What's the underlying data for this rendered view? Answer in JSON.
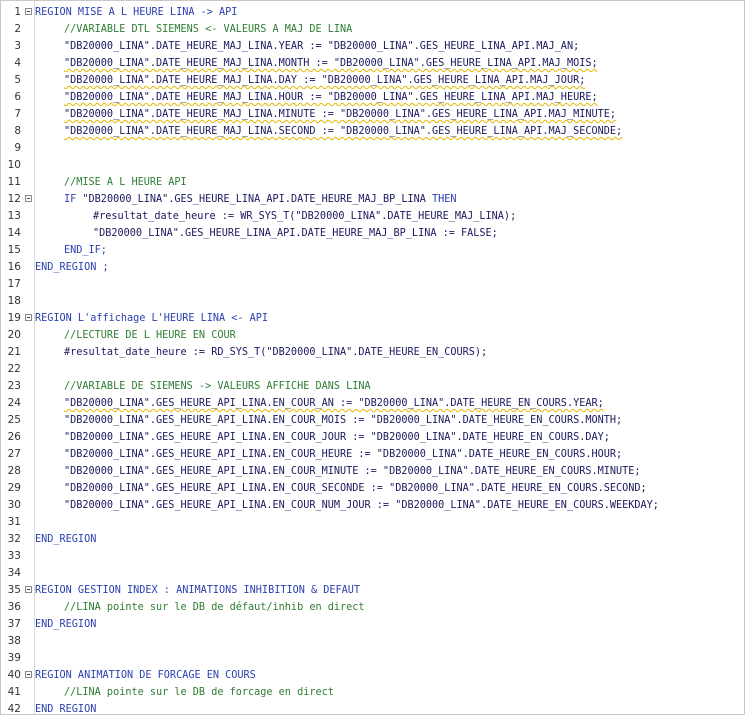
{
  "editor": {
    "lines": [
      {
        "n": "1",
        "fold": true,
        "indent": 0,
        "kind": "kw",
        "squig": false,
        "text": "REGION MISE A L HEURE LINA -> API"
      },
      {
        "n": "2",
        "fold": false,
        "indent": 1,
        "kind": "cm",
        "squig": false,
        "text": "//VARIABLE DTL SIEMENS <- VALEURS A MAJ DE LINA"
      },
      {
        "n": "3",
        "fold": false,
        "indent": 1,
        "kind": "id",
        "squig": false,
        "text": "\"DB20000_LINA\".DATE_HEURE_MAJ_LINA.YEAR := \"DB20000_LINA\".GES_HEURE_LINA_API.MAJ_AN;"
      },
      {
        "n": "4",
        "fold": false,
        "indent": 1,
        "kind": "id",
        "squig": true,
        "text": "\"DB20000_LINA\".DATE_HEURE_MAJ_LINA.MONTH := \"DB20000_LINA\".GES_HEURE_LINA_API.MAJ_MOIS;"
      },
      {
        "n": "5",
        "fold": false,
        "indent": 1,
        "kind": "id",
        "squig": true,
        "text": "\"DB20000_LINA\".DATE_HEURE_MAJ_LINA.DAY := \"DB20000_LINA\".GES_HEURE_LINA_API.MAJ_JOUR;"
      },
      {
        "n": "6",
        "fold": false,
        "indent": 1,
        "kind": "id",
        "squig": true,
        "text": "\"DB20000_LINA\".DATE_HEURE_MAJ_LINA.HOUR := \"DB20000_LINA\".GES_HEURE_LINA_API.MAJ_HEURE;"
      },
      {
        "n": "7",
        "fold": false,
        "indent": 1,
        "kind": "id",
        "squig": true,
        "text": "\"DB20000_LINA\".DATE_HEURE_MAJ_LINA.MINUTE := \"DB20000_LINA\".GES_HEURE_LINA_API.MAJ_MINUTE;"
      },
      {
        "n": "8",
        "fold": false,
        "indent": 1,
        "kind": "id",
        "squig": true,
        "text": "\"DB20000_LINA\".DATE_HEURE_MAJ_LINA.SECOND := \"DB20000_LINA\".GES_HEURE_LINA_API.MAJ_SECONDE;"
      },
      {
        "n": "9",
        "fold": false,
        "indent": 0,
        "kind": "id",
        "squig": false,
        "text": ""
      },
      {
        "n": "10",
        "fold": false,
        "indent": 0,
        "kind": "id",
        "squig": false,
        "text": ""
      },
      {
        "n": "11",
        "fold": false,
        "indent": 1,
        "kind": "cm",
        "squig": false,
        "text": "//MISE A L HEURE API"
      },
      {
        "n": "12",
        "fold": true,
        "indent": 1,
        "kind": "if",
        "squig": false,
        "text": "\"DB20000_LINA\".GES_HEURE_LINA_API.DATE_HEURE_MAJ_BP_LINA ",
        "kw1": "IF ",
        "kw2": "THEN"
      },
      {
        "n": "13",
        "fold": false,
        "indent": 2,
        "kind": "id",
        "squig": false,
        "text": "#resultat_date_heure := WR_SYS_T(\"DB20000_LINA\".DATE_HEURE_MAJ_LINA);"
      },
      {
        "n": "14",
        "fold": false,
        "indent": 2,
        "kind": "id",
        "squig": false,
        "text": "\"DB20000_LINA\".GES_HEURE_LINA_API.DATE_HEURE_MAJ_BP_LINA := FALSE;"
      },
      {
        "n": "15",
        "fold": false,
        "indent": 1,
        "kind": "kw",
        "squig": false,
        "text": "END_IF;"
      },
      {
        "n": "16",
        "fold": false,
        "indent": 0,
        "kind": "kw",
        "squig": false,
        "text": "END_REGION ;"
      },
      {
        "n": "17",
        "fold": false,
        "indent": 0,
        "kind": "id",
        "squig": false,
        "text": ""
      },
      {
        "n": "18",
        "fold": false,
        "indent": 0,
        "kind": "id",
        "squig": false,
        "text": ""
      },
      {
        "n": "19",
        "fold": true,
        "indent": 0,
        "kind": "kw",
        "squig": false,
        "text": "REGION L'affichage L'HEURE LINA <- API"
      },
      {
        "n": "20",
        "fold": false,
        "indent": 1,
        "kind": "cm",
        "squig": false,
        "text": "//LECTURE DE L HEURE EN COUR"
      },
      {
        "n": "21",
        "fold": false,
        "indent": 1,
        "kind": "id",
        "squig": false,
        "text": "#resultat_date_heure := RD_SYS_T(\"DB20000_LINA\".DATE_HEURE_EN_COURS);"
      },
      {
        "n": "22",
        "fold": false,
        "indent": 0,
        "kind": "id",
        "squig": false,
        "text": ""
      },
      {
        "n": "23",
        "fold": false,
        "indent": 1,
        "kind": "cm",
        "squig": false,
        "text": "//VARIABLE DE SIEMENS -> VALEURS AFFICHE DANS LINA"
      },
      {
        "n": "24",
        "fold": false,
        "indent": 1,
        "kind": "id",
        "squig": true,
        "text": "\"DB20000_LINA\".GES_HEURE_API_LINA.EN_COUR_AN := \"DB20000_LINA\".DATE_HEURE_EN_COURS.YEAR;"
      },
      {
        "n": "25",
        "fold": false,
        "indent": 1,
        "kind": "id",
        "squig": false,
        "text": "\"DB20000_LINA\".GES_HEURE_API_LINA.EN_COUR_MOIS := \"DB20000_LINA\".DATE_HEURE_EN_COURS.MONTH;"
      },
      {
        "n": "26",
        "fold": false,
        "indent": 1,
        "kind": "id",
        "squig": false,
        "text": "\"DB20000_LINA\".GES_HEURE_API_LINA.EN_COUR_JOUR := \"DB20000_LINA\".DATE_HEURE_EN_COURS.DAY;"
      },
      {
        "n": "27",
        "fold": false,
        "indent": 1,
        "kind": "id",
        "squig": false,
        "text": "\"DB20000_LINA\".GES_HEURE_API_LINA.EN_COUR_HEURE := \"DB20000_LINA\".DATE_HEURE_EN_COURS.HOUR;"
      },
      {
        "n": "28",
        "fold": false,
        "indent": 1,
        "kind": "id",
        "squig": false,
        "text": "\"DB20000_LINA\".GES_HEURE_API_LINA.EN_COUR_MINUTE := \"DB20000_LINA\".DATE_HEURE_EN_COURS.MINUTE;"
      },
      {
        "n": "29",
        "fold": false,
        "indent": 1,
        "kind": "id",
        "squig": false,
        "text": "\"DB20000_LINA\".GES_HEURE_API_LINA.EN_COUR_SECONDE := \"DB20000_LINA\".DATE_HEURE_EN_COURS.SECOND;"
      },
      {
        "n": "30",
        "fold": false,
        "indent": 1,
        "kind": "id",
        "squig": false,
        "text": "\"DB20000_LINA\".GES_HEURE_API_LINA.EN_COUR_NUM_JOUR := \"DB20000_LINA\".DATE_HEURE_EN_COURS.WEEKDAY;"
      },
      {
        "n": "31",
        "fold": false,
        "indent": 0,
        "kind": "id",
        "squig": false,
        "text": ""
      },
      {
        "n": "32",
        "fold": false,
        "indent": 0,
        "kind": "kw",
        "squig": false,
        "text": "END_REGION"
      },
      {
        "n": "33",
        "fold": false,
        "indent": 0,
        "kind": "id",
        "squig": false,
        "text": ""
      },
      {
        "n": "34",
        "fold": false,
        "indent": 0,
        "kind": "id",
        "squig": false,
        "text": ""
      },
      {
        "n": "35",
        "fold": true,
        "indent": 0,
        "kind": "kw",
        "squig": false,
        "text": "REGION GESTION INDEX : ANIMATIONS INHIBITION & DEFAUT"
      },
      {
        "n": "36",
        "fold": false,
        "indent": 1,
        "kind": "cm",
        "squig": false,
        "text": "//LINA pointe sur le DB de défaut/inhib en direct"
      },
      {
        "n": "37",
        "fold": false,
        "indent": 0,
        "kind": "kw",
        "squig": false,
        "text": "END_REGION"
      },
      {
        "n": "38",
        "fold": false,
        "indent": 0,
        "kind": "id",
        "squig": false,
        "text": ""
      },
      {
        "n": "39",
        "fold": false,
        "indent": 0,
        "kind": "id",
        "squig": false,
        "text": ""
      },
      {
        "n": "40",
        "fold": true,
        "indent": 0,
        "kind": "kw",
        "squig": false,
        "text": "REGION ANIMATION DE FORCAGE EN COURS"
      },
      {
        "n": "41",
        "fold": false,
        "indent": 1,
        "kind": "cm",
        "squig": false,
        "text": "//LINA pointe sur le DB de forcage en direct"
      },
      {
        "n": "42",
        "fold": false,
        "indent": 0,
        "kind": "kw",
        "squig": false,
        "text": "END_REGION"
      }
    ]
  }
}
